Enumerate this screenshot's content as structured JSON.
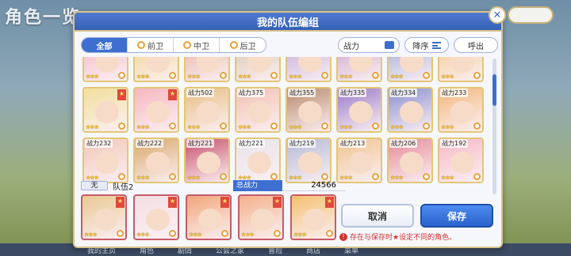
{
  "background": {
    "title": "角色一览",
    "nav": [
      "我的主页",
      "角色",
      "剧情",
      "公会之家",
      "冒险",
      "商店",
      "菜单"
    ]
  },
  "dialog": {
    "title": "我的队伍编组",
    "close_icon": "close-icon"
  },
  "filters": {
    "tabs": [
      {
        "label": "全部",
        "active": true
      },
      {
        "label": "前卫",
        "active": false
      },
      {
        "label": "中卫",
        "active": false
      },
      {
        "label": "后卫",
        "active": false
      }
    ],
    "sort_label": "战力",
    "order_label": "降序",
    "call_label": "呼出"
  },
  "roster": {
    "rows": [
      [
        {
          "power": "",
          "color": "#f4b7c4",
          "stars": "★★★"
        },
        {
          "power": "",
          "color": "#f1d38a",
          "stars": "★★★"
        },
        {
          "power": "",
          "color": "#e8b0a0",
          "stars": "★★★"
        },
        {
          "power": "",
          "color": "#d9c4a8",
          "stars": "★★★"
        },
        {
          "power": "",
          "color": "#bfa7d9",
          "stars": "★★★"
        },
        {
          "power": "",
          "color": "#c9a3c9",
          "stars": "★★★"
        },
        {
          "power": "",
          "color": "#9ea7d8",
          "stars": "★★★"
        },
        {
          "power": "",
          "color": "#f4c98a",
          "stars": "★★★"
        }
      ],
      [
        {
          "power": "",
          "color": "#f2df9c",
          "stars": "★★★",
          "flag": true
        },
        {
          "power": "",
          "color": "#f6b6c0",
          "stars": "★★★",
          "flag": true
        },
        {
          "power": "战力502",
          "color": "#e8bf86",
          "stars": "★★★"
        },
        {
          "power": "战力375",
          "color": "#f2c0b0",
          "stars": "★★★"
        },
        {
          "power": "战力355",
          "color": "#b88a6a",
          "stars": "★★★"
        },
        {
          "power": "战力335",
          "color": "#9a7bc8",
          "stars": "★★★"
        },
        {
          "power": "战力334",
          "color": "#8a8fd0",
          "stars": "★★★"
        },
        {
          "power": "战力233",
          "color": "#f2b87c",
          "stars": "★★★"
        }
      ],
      [
        {
          "power": "战力232",
          "color": "#f2c6b8",
          "stars": "★★★"
        },
        {
          "power": "战力222",
          "color": "#d9a86a",
          "stars": "★★★"
        },
        {
          "power": "战力221",
          "color": "#c7506c",
          "stars": "★★★"
        },
        {
          "power": "战力221",
          "color": "#e7e3ea",
          "stars": "★★★"
        },
        {
          "power": "战力219",
          "color": "#b5b9d6",
          "stars": "★★★"
        },
        {
          "power": "战力213",
          "color": "#f0c38e",
          "stars": "★★★"
        },
        {
          "power": "战力206",
          "color": "#e58a98",
          "stars": "★★★"
        },
        {
          "power": "战力192",
          "color": "#f7b8c6",
          "stars": "★★★"
        }
      ]
    ],
    "scroll_position": 0.15
  },
  "team": {
    "tag": "无",
    "name": "队伍2",
    "total_power_label": "总战力",
    "total_power": "24566",
    "members": [
      {
        "color": "#e9c992",
        "stars": "★★★",
        "flag": true
      },
      {
        "color": "#f3dfe4",
        "stars": "★★★",
        "flag": true
      },
      {
        "color": "#f2a578",
        "stars": "★★★",
        "flag": true
      },
      {
        "color": "#f4b08a",
        "stars": "★★★",
        "flag": true
      },
      {
        "color": "#f3c070",
        "stars": "★★★",
        "flag": true
      }
    ]
  },
  "actions": {
    "cancel": "取消",
    "save": "保存"
  },
  "warning": "存在与保存时★设定不同的角色。"
}
